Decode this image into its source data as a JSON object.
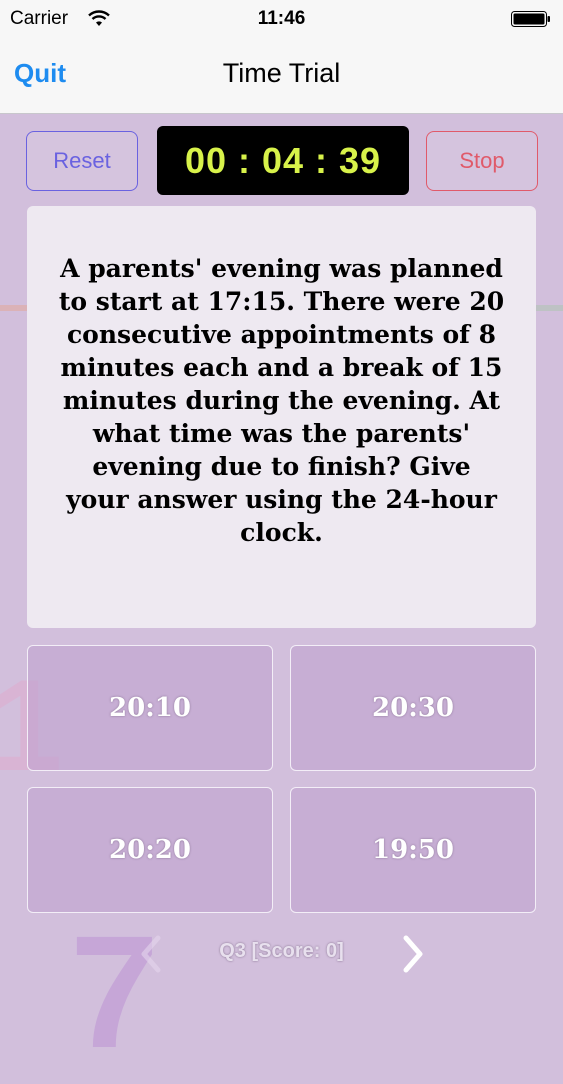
{
  "status_bar": {
    "carrier": "Carrier",
    "time": "11:46",
    "wifi_icon": "wifi-icon",
    "battery_icon": "battery-icon"
  },
  "nav": {
    "back_label": "Quit",
    "title": "Time Trial"
  },
  "controls": {
    "reset_label": "Reset",
    "timer": "00 : 04 : 39",
    "stop_label": "Stop"
  },
  "question": {
    "text": "A parents' evening was planned to start at 17:15.  There were 20 consecutive appointments of 8 minutes each and a break of 15 minutes during the evening.  At what time was the parents' evening due to finish?  Give your answer using the 24-hour clock."
  },
  "answers": [
    "20:10",
    "20:30",
    "20:20",
    "19:50"
  ],
  "footer": {
    "status": "Q3 [Score: 0]",
    "prev_icon": "chevron-left-icon",
    "next_icon": "chevron-right-icon"
  },
  "colors": {
    "background": "#d2bfdc",
    "accent": "#1e8cf0",
    "reset": "#6a62e0",
    "stop": "#e05a6a",
    "timer_text": "#d8f24a"
  }
}
